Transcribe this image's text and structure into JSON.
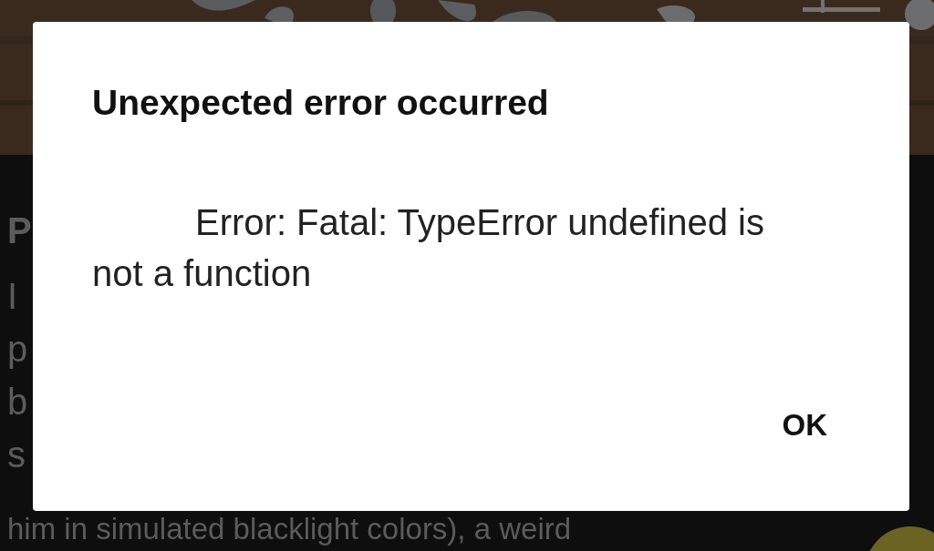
{
  "background": {
    "article_lines": [
      "P",
      "I",
      "p",
      "b",
      "s",
      "him in simulated blacklight colors), a weird"
    ]
  },
  "dialog": {
    "title": "Unexpected error occurred",
    "message": "Error: Fatal: TypeError undefined is not a function",
    "buttons": [
      "OK"
    ]
  }
}
